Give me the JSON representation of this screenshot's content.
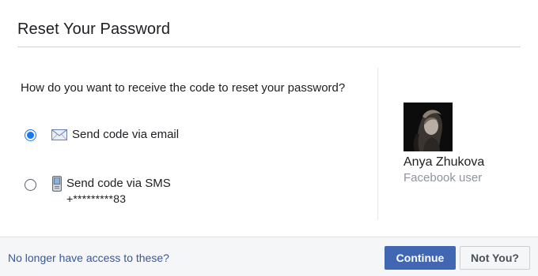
{
  "dialog": {
    "title": "Reset Your Password"
  },
  "question": "How do you want to receive the code to reset your password?",
  "options": [
    {
      "label": "Send code via email",
      "icon": "envelope-icon",
      "selected": true
    },
    {
      "label": "Send code via SMS",
      "sub": "+*********83",
      "icon": "mobile-phone-icon",
      "selected": false
    }
  ],
  "user": {
    "name": "Anya Zhukova",
    "subtitle": "Facebook user"
  },
  "footer": {
    "link": "No longer have access to these?",
    "continue_label": "Continue",
    "not_you_label": "Not You?"
  },
  "colors": {
    "accent": "#1877f2",
    "primary_button": "#4267b2",
    "link": "#385898",
    "muted_text": "#8d949e",
    "footer_bg": "#f5f6f7"
  }
}
